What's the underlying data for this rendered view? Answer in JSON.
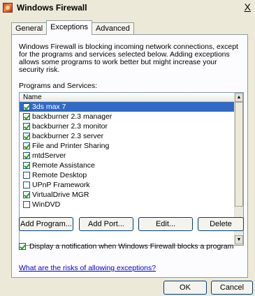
{
  "window": {
    "title": "Windows Firewall",
    "close_label": "X"
  },
  "tabs": [
    {
      "label": "General"
    },
    {
      "label": "Exceptions"
    },
    {
      "label": "Advanced"
    }
  ],
  "exceptions": {
    "description": "Windows Firewall is blocking incoming network connections, except for the programs and services selected below. Adding exceptions allows some programs to work better but might increase your security risk.",
    "group_label": "Programs and Services:",
    "column_header": "Name",
    "items": [
      {
        "label": "3ds max 7",
        "checked": true,
        "selected": true
      },
      {
        "label": "backburner 2.3 manager",
        "checked": true
      },
      {
        "label": "backburner 2.3 monitor",
        "checked": true
      },
      {
        "label": "backburner 2.3 server",
        "checked": true
      },
      {
        "label": "File and Printer Sharing",
        "checked": true
      },
      {
        "label": "mtdServer",
        "checked": true
      },
      {
        "label": "Remote Assistance",
        "checked": true
      },
      {
        "label": "Remote Desktop",
        "checked": false
      },
      {
        "label": "UPnP Framework",
        "checked": false
      },
      {
        "label": "VirtualDrive MGR",
        "checked": true
      },
      {
        "label": "WinDVD",
        "checked": false
      }
    ],
    "buttons": {
      "add_program": "Add Program...",
      "add_port": "Add Port...",
      "edit": "Edit...",
      "delete": "Delete"
    },
    "notify_label": "Display a notification when Windows Firewall blocks a program",
    "notify_checked": true,
    "risk_link": "What are the risks of allowing exceptions?"
  },
  "footer": {
    "ok": "OK",
    "cancel": "Cancel"
  }
}
